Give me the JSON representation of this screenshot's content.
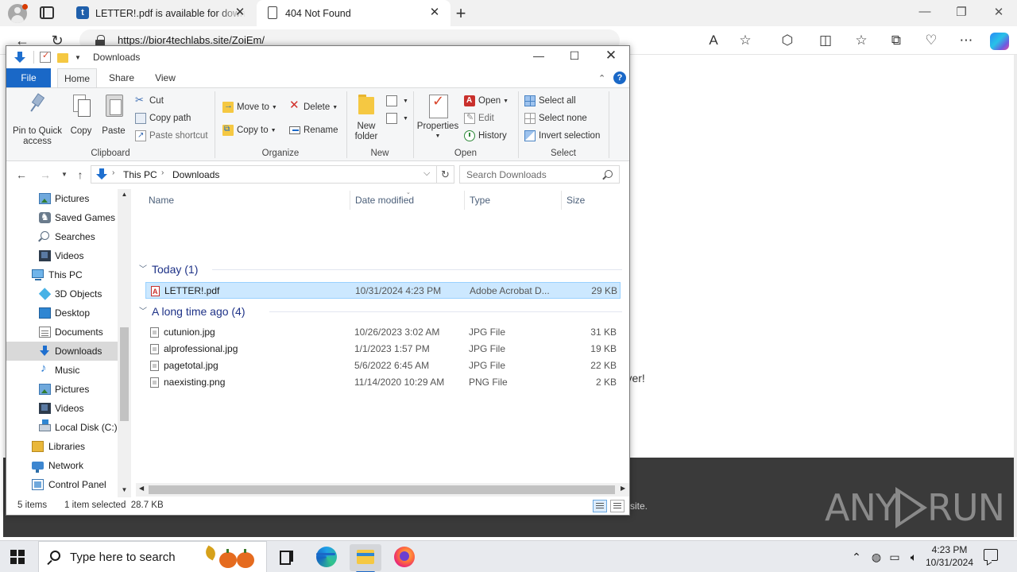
{
  "browser": {
    "tabs": [
      {
        "title": "LETTER!.pdf is available for download"
      },
      {
        "title": "404 Not Found"
      }
    ],
    "url": "https://bior4techlabs.site/ZoiEm/",
    "page_fragments": {
      "server_text": "erver!",
      "footer_text": "site."
    },
    "watermark": "ANY RUN"
  },
  "explorer": {
    "title": "Downloads",
    "ribbon_tabs": [
      "File",
      "Home",
      "Share",
      "View"
    ],
    "ribbon": {
      "clipboard": {
        "label": "Clipboard",
        "pin": "Pin to Quick access",
        "copy": "Copy",
        "paste": "Paste",
        "cut": "Cut",
        "copy_path": "Copy path",
        "paste_shortcut": "Paste shortcut"
      },
      "organize": {
        "label": "Organize",
        "move_to": "Move to",
        "copy_to": "Copy to",
        "delete": "Delete",
        "rename": "Rename"
      },
      "new": {
        "label": "New",
        "new_folder": "New folder"
      },
      "open": {
        "label": "Open",
        "properties": "Properties",
        "open": "Open",
        "edit": "Edit",
        "history": "History"
      },
      "select": {
        "label": "Select",
        "select_all": "Select all",
        "select_none": "Select none",
        "invert_selection": "Invert selection"
      }
    },
    "address": {
      "crumbs": [
        "This PC",
        "Downloads"
      ],
      "search_placeholder": "Search Downloads"
    },
    "nav_items": [
      {
        "label": "Pictures",
        "icon": "pictures-icon"
      },
      {
        "label": "Saved Games",
        "icon": "saved-games-icon"
      },
      {
        "label": "Searches",
        "icon": "searches-icon"
      },
      {
        "label": "Videos",
        "icon": "videos-icon"
      },
      {
        "label": "This PC",
        "icon": "this-pc-icon"
      },
      {
        "label": "3D Objects",
        "icon": "3d-objects-icon"
      },
      {
        "label": "Desktop",
        "icon": "desktop-icon"
      },
      {
        "label": "Documents",
        "icon": "documents-icon"
      },
      {
        "label": "Downloads",
        "icon": "downloads-icon"
      },
      {
        "label": "Music",
        "icon": "music-icon"
      },
      {
        "label": "Pictures",
        "icon": "pictures-icon"
      },
      {
        "label": "Videos",
        "icon": "videos-icon"
      },
      {
        "label": "Local Disk (C:)",
        "icon": "local-disk-icon"
      },
      {
        "label": "Libraries",
        "icon": "libraries-icon"
      },
      {
        "label": "Network",
        "icon": "network-icon"
      },
      {
        "label": "Control Panel",
        "icon": "control-panel-icon"
      }
    ],
    "columns": [
      "Name",
      "Date modified",
      "Type",
      "Size"
    ],
    "groups": [
      {
        "title": "Today (1)",
        "files": [
          {
            "name": "LETTER!.pdf",
            "date": "10/31/2024 4:23 PM",
            "type": "Adobe Acrobat D...",
            "size": "29 KB"
          }
        ]
      },
      {
        "title": "A long time ago (4)",
        "files": [
          {
            "name": "cutunion.jpg",
            "date": "10/26/2023 3:02 AM",
            "type": "JPG File",
            "size": "31 KB"
          },
          {
            "name": "alprofessional.jpg",
            "date": "1/1/2023 1:57 PM",
            "type": "JPG File",
            "size": "19 KB"
          },
          {
            "name": "pagetotal.jpg",
            "date": "5/6/2022 6:45 AM",
            "type": "JPG File",
            "size": "22 KB"
          },
          {
            "name": "naexisting.png",
            "date": "11/14/2020 10:29 AM",
            "type": "PNG File",
            "size": "2 KB"
          }
        ]
      }
    ],
    "status": {
      "item_count": "5 items",
      "selection": "1 item selected  28.7 KB"
    }
  },
  "taskbar": {
    "search_placeholder": "Type here to search",
    "time": "4:23 PM",
    "date": "10/31/2024"
  },
  "colors": {
    "accent": "#1a68c7",
    "selection": "#cce8ff",
    "group_header": "#1e3287"
  }
}
